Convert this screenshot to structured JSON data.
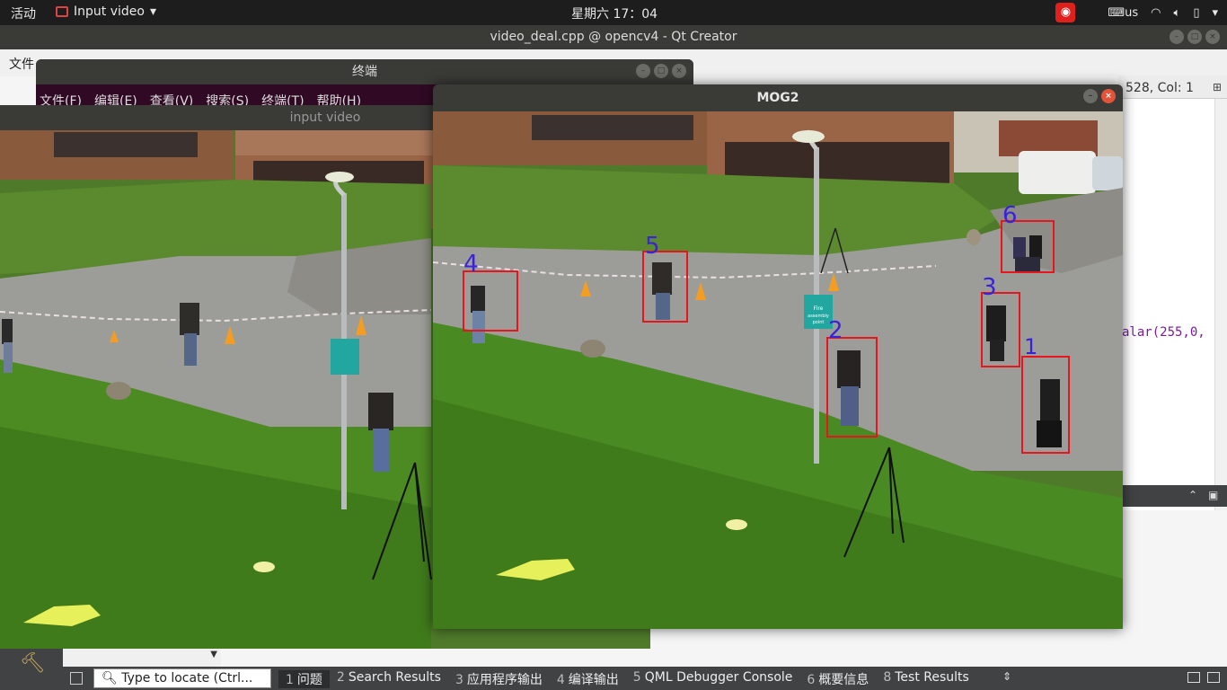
{
  "topbar": {
    "activities": "活动",
    "app_menu": "Input video",
    "clock": "星期六 17：04",
    "keyboard": "us"
  },
  "qt": {
    "title": "video_deal.cpp @ opencv4 - Qt Creator",
    "menu_first": "文件",
    "editor_position": "528, Col: 1",
    "code_fragment": "alar(255,0,"
  },
  "terminal": {
    "title": "终端",
    "menu": [
      "文件(F)",
      "编辑(E)",
      "查看(V)",
      "搜索(S)",
      "终端(T)",
      "帮助(H)"
    ]
  },
  "input_video": {
    "title": "input video"
  },
  "mog2": {
    "title": "MOG2",
    "detections": [
      {
        "label": "1"
      },
      {
        "label": "2"
      },
      {
        "label": "3"
      },
      {
        "label": "4"
      },
      {
        "label": "5"
      },
      {
        "label": "6"
      }
    ],
    "box_color": "#e8141e",
    "label_color": "#3a22d8"
  },
  "sign": {
    "text1": "Fire",
    "text2": "assembly",
    "text3": "point"
  },
  "statusbar": {
    "locator_placeholder": "Type to locate (Ctrl...",
    "tabs": [
      {
        "num": "1",
        "label": "问题"
      },
      {
        "num": "2",
        "label": "Search Results"
      },
      {
        "num": "3",
        "label": "应用程序输出"
      },
      {
        "num": "4",
        "label": "编译输出"
      },
      {
        "num": "5",
        "label": "QML Debugger Console"
      },
      {
        "num": "6",
        "label": "概要信息"
      },
      {
        "num": "8",
        "label": "Test Results"
      }
    ]
  }
}
